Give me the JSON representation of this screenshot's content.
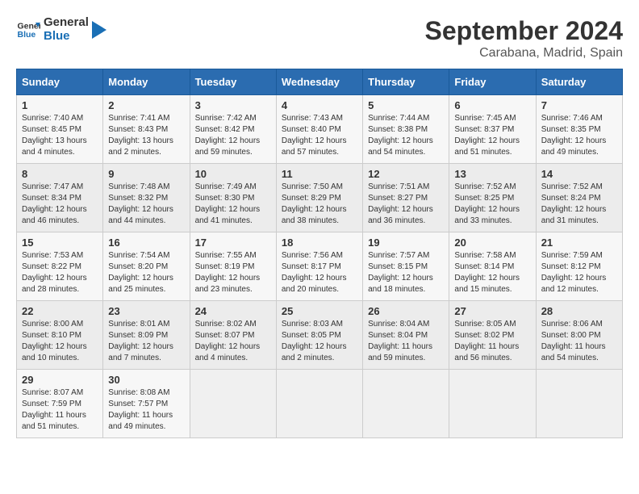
{
  "logo": {
    "text_general": "General",
    "text_blue": "Blue"
  },
  "header": {
    "month": "September 2024",
    "location": "Carabana, Madrid, Spain"
  },
  "weekdays": [
    "Sunday",
    "Monday",
    "Tuesday",
    "Wednesday",
    "Thursday",
    "Friday",
    "Saturday"
  ],
  "weeks": [
    [
      {
        "day": "1",
        "sunrise": "7:40 AM",
        "sunset": "8:45 PM",
        "daylight": "13 hours and 4 minutes."
      },
      {
        "day": "2",
        "sunrise": "7:41 AM",
        "sunset": "8:43 PM",
        "daylight": "13 hours and 2 minutes."
      },
      {
        "day": "3",
        "sunrise": "7:42 AM",
        "sunset": "8:42 PM",
        "daylight": "12 hours and 59 minutes."
      },
      {
        "day": "4",
        "sunrise": "7:43 AM",
        "sunset": "8:40 PM",
        "daylight": "12 hours and 57 minutes."
      },
      {
        "day": "5",
        "sunrise": "7:44 AM",
        "sunset": "8:38 PM",
        "daylight": "12 hours and 54 minutes."
      },
      {
        "day": "6",
        "sunrise": "7:45 AM",
        "sunset": "8:37 PM",
        "daylight": "12 hours and 51 minutes."
      },
      {
        "day": "7",
        "sunrise": "7:46 AM",
        "sunset": "8:35 PM",
        "daylight": "12 hours and 49 minutes."
      }
    ],
    [
      {
        "day": "8",
        "sunrise": "7:47 AM",
        "sunset": "8:34 PM",
        "daylight": "12 hours and 46 minutes."
      },
      {
        "day": "9",
        "sunrise": "7:48 AM",
        "sunset": "8:32 PM",
        "daylight": "12 hours and 44 minutes."
      },
      {
        "day": "10",
        "sunrise": "7:49 AM",
        "sunset": "8:30 PM",
        "daylight": "12 hours and 41 minutes."
      },
      {
        "day": "11",
        "sunrise": "7:50 AM",
        "sunset": "8:29 PM",
        "daylight": "12 hours and 38 minutes."
      },
      {
        "day": "12",
        "sunrise": "7:51 AM",
        "sunset": "8:27 PM",
        "daylight": "12 hours and 36 minutes."
      },
      {
        "day": "13",
        "sunrise": "7:52 AM",
        "sunset": "8:25 PM",
        "daylight": "12 hours and 33 minutes."
      },
      {
        "day": "14",
        "sunrise": "7:52 AM",
        "sunset": "8:24 PM",
        "daylight": "12 hours and 31 minutes."
      }
    ],
    [
      {
        "day": "15",
        "sunrise": "7:53 AM",
        "sunset": "8:22 PM",
        "daylight": "12 hours and 28 minutes."
      },
      {
        "day": "16",
        "sunrise": "7:54 AM",
        "sunset": "8:20 PM",
        "daylight": "12 hours and 25 minutes."
      },
      {
        "day": "17",
        "sunrise": "7:55 AM",
        "sunset": "8:19 PM",
        "daylight": "12 hours and 23 minutes."
      },
      {
        "day": "18",
        "sunrise": "7:56 AM",
        "sunset": "8:17 PM",
        "daylight": "12 hours and 20 minutes."
      },
      {
        "day": "19",
        "sunrise": "7:57 AM",
        "sunset": "8:15 PM",
        "daylight": "12 hours and 18 minutes."
      },
      {
        "day": "20",
        "sunrise": "7:58 AM",
        "sunset": "8:14 PM",
        "daylight": "12 hours and 15 minutes."
      },
      {
        "day": "21",
        "sunrise": "7:59 AM",
        "sunset": "8:12 PM",
        "daylight": "12 hours and 12 minutes."
      }
    ],
    [
      {
        "day": "22",
        "sunrise": "8:00 AM",
        "sunset": "8:10 PM",
        "daylight": "12 hours and 10 minutes."
      },
      {
        "day": "23",
        "sunrise": "8:01 AM",
        "sunset": "8:09 PM",
        "daylight": "12 hours and 7 minutes."
      },
      {
        "day": "24",
        "sunrise": "8:02 AM",
        "sunset": "8:07 PM",
        "daylight": "12 hours and 4 minutes."
      },
      {
        "day": "25",
        "sunrise": "8:03 AM",
        "sunset": "8:05 PM",
        "daylight": "12 hours and 2 minutes."
      },
      {
        "day": "26",
        "sunrise": "8:04 AM",
        "sunset": "8:04 PM",
        "daylight": "11 hours and 59 minutes."
      },
      {
        "day": "27",
        "sunrise": "8:05 AM",
        "sunset": "8:02 PM",
        "daylight": "11 hours and 56 minutes."
      },
      {
        "day": "28",
        "sunrise": "8:06 AM",
        "sunset": "8:00 PM",
        "daylight": "11 hours and 54 minutes."
      }
    ],
    [
      {
        "day": "29",
        "sunrise": "8:07 AM",
        "sunset": "7:59 PM",
        "daylight": "11 hours and 51 minutes."
      },
      {
        "day": "30",
        "sunrise": "8:08 AM",
        "sunset": "7:57 PM",
        "daylight": "11 hours and 49 minutes."
      },
      null,
      null,
      null,
      null,
      null
    ]
  ]
}
